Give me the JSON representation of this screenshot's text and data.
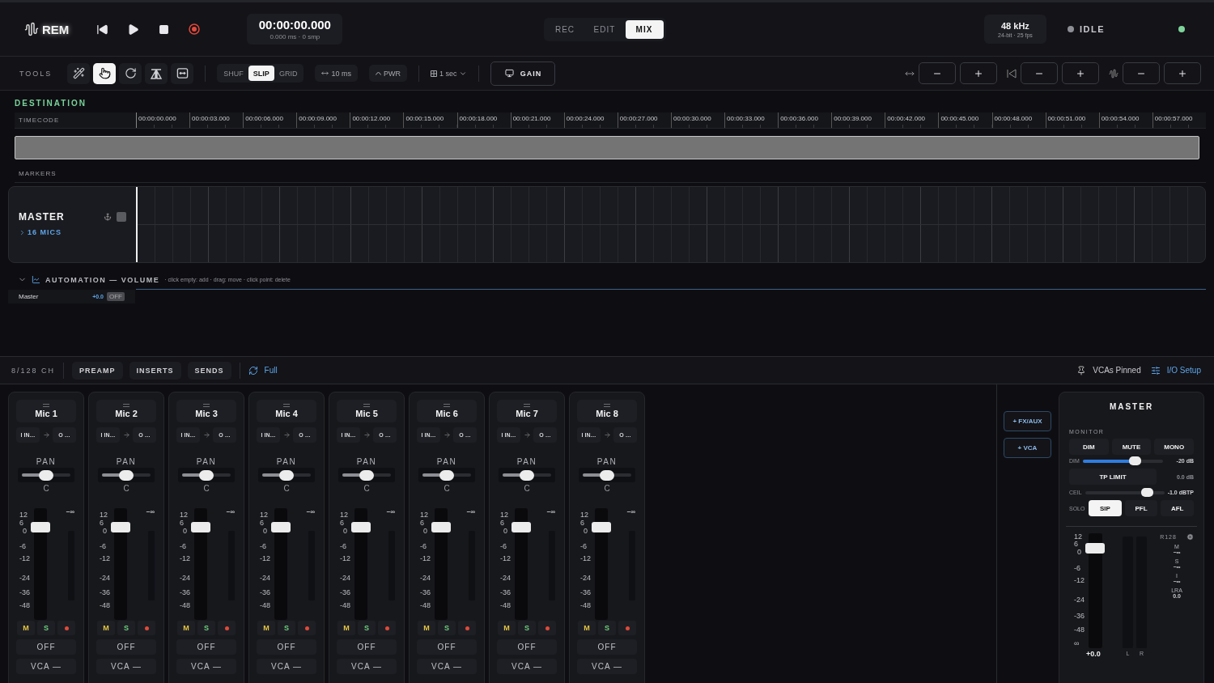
{
  "topbar": {
    "logo": "REM",
    "timecode": {
      "value": "00:00:00.000",
      "sub": "0.000 ms · 0 smp"
    },
    "modes": [
      {
        "label": "REC",
        "selected": false
      },
      {
        "label": "EDIT",
        "selected": false
      },
      {
        "label": "MIX",
        "selected": true
      }
    ],
    "format": {
      "rate": "48 kHz",
      "detail": "24-bit · 25 fps"
    },
    "status": "IDLE"
  },
  "toolbar": {
    "label": "TOOLS",
    "tools": [
      {
        "selected": false
      },
      {
        "selected": true
      },
      {
        "selected": false
      },
      {
        "selected": false
      },
      {
        "selected": false
      }
    ],
    "edit_modes": [
      {
        "label": "SHUF",
        "selected": false
      },
      {
        "label": "SLIP",
        "selected": true
      },
      {
        "label": "GRID",
        "selected": false
      }
    ],
    "nudge": "10 ms",
    "fade": "PWR",
    "grid": "1 sec",
    "gain": "GAIN"
  },
  "destination": {
    "title": "DESTINATION",
    "ruler_label": "TIMECODE",
    "ticks": [
      "00:00:00.000",
      "00:00:03.000",
      "00:00:06.000",
      "00:00:09.000",
      "00:00:12.000",
      "00:00:15.000",
      "00:00:18.000",
      "00:00:21.000",
      "00:00:24.000",
      "00:00:27.000",
      "00:00:30.000",
      "00:00:33.000",
      "00:00:36.000",
      "00:00:39.000",
      "00:00:42.000",
      "00:00:45.000",
      "00:00:48.000",
      "00:00:51.000",
      "00:00:54.000",
      "00:00:57.000"
    ],
    "markers_label": "MARKERS",
    "track": {
      "name": "MASTER",
      "group": "16 MICS"
    },
    "automation": {
      "title": "AUTOMATION — VOLUME",
      "hint": "· click empty: add · drag: move · click point: delete",
      "lanes": [
        {
          "name": "Master",
          "value": "+0.0",
          "toggle": "OFF"
        }
      ]
    }
  },
  "mixer": {
    "count": "8/128 CH",
    "sections": [
      "PREAMP",
      "INSERTS",
      "SENDS"
    ],
    "view": "Full",
    "pinned": "VCAs Pinned",
    "io": "I/O Setup",
    "channels": [
      {
        "name": "Mic 1",
        "input": "I IN…",
        "output": "O …",
        "pan_label": "PAN",
        "pan": {
          "level": 0.5
        },
        "pan_reading": "C",
        "peak": "−∞",
        "scale": [
          "12",
          "6",
          "0",
          "-6",
          "-12",
          "-24",
          "-36",
          "-48"
        ],
        "fader": {
          "level": 0.83
        },
        "mute": "M",
        "solo": "S",
        "automation": "OFF",
        "vca": "VCA —"
      },
      {
        "name": "Mic 2",
        "input": "I IN…",
        "output": "O …",
        "pan_label": "PAN",
        "pan": {
          "level": 0.5
        },
        "pan_reading": "C",
        "peak": "−∞",
        "scale": [
          "12",
          "6",
          "0",
          "-6",
          "-12",
          "-24",
          "-36",
          "-48"
        ],
        "fader": {
          "level": 0.83
        },
        "mute": "M",
        "solo": "S",
        "automation": "OFF",
        "vca": "VCA —"
      },
      {
        "name": "Mic 3",
        "input": "I IN…",
        "output": "O …",
        "pan_label": "PAN",
        "pan": {
          "level": 0.5
        },
        "pan_reading": "C",
        "peak": "−∞",
        "scale": [
          "12",
          "6",
          "0",
          "-6",
          "-12",
          "-24",
          "-36",
          "-48"
        ],
        "fader": {
          "level": 0.83
        },
        "mute": "M",
        "solo": "S",
        "automation": "OFF",
        "vca": "VCA —"
      },
      {
        "name": "Mic 4",
        "input": "I IN…",
        "output": "O …",
        "pan_label": "PAN",
        "pan": {
          "level": 0.5
        },
        "pan_reading": "C",
        "peak": "−∞",
        "scale": [
          "12",
          "6",
          "0",
          "-6",
          "-12",
          "-24",
          "-36",
          "-48"
        ],
        "fader": {
          "level": 0.83
        },
        "mute": "M",
        "solo": "S",
        "automation": "OFF",
        "vca": "VCA —"
      },
      {
        "name": "Mic 5",
        "input": "I IN…",
        "output": "O …",
        "pan_label": "PAN",
        "pan": {
          "level": 0.5
        },
        "pan_reading": "C",
        "peak": "−∞",
        "scale": [
          "12",
          "6",
          "0",
          "-6",
          "-12",
          "-24",
          "-36",
          "-48"
        ],
        "fader": {
          "level": 0.83
        },
        "mute": "M",
        "solo": "S",
        "automation": "OFF",
        "vca": "VCA —"
      },
      {
        "name": "Mic 6",
        "input": "I IN…",
        "output": "O …",
        "pan_label": "PAN",
        "pan": {
          "level": 0.5
        },
        "pan_reading": "C",
        "peak": "−∞",
        "scale": [
          "12",
          "6",
          "0",
          "-6",
          "-12",
          "-24",
          "-36",
          "-48"
        ],
        "fader": {
          "level": 0.83
        },
        "mute": "M",
        "solo": "S",
        "automation": "OFF",
        "vca": "VCA —"
      },
      {
        "name": "Mic 7",
        "input": "I IN…",
        "output": "O …",
        "pan_label": "PAN",
        "pan": {
          "level": 0.5
        },
        "pan_reading": "C",
        "peak": "−∞",
        "scale": [
          "12",
          "6",
          "0",
          "-6",
          "-12",
          "-24",
          "-36",
          "-48"
        ],
        "fader": {
          "level": 0.83
        },
        "mute": "M",
        "solo": "S",
        "automation": "OFF",
        "vca": "VCA —"
      },
      {
        "name": "Mic 8",
        "input": "I IN…",
        "output": "O …",
        "pan_label": "PAN",
        "pan": {
          "level": 0.5
        },
        "pan_reading": "C",
        "peak": "−∞",
        "scale": [
          "12",
          "6",
          "0",
          "-6",
          "-12",
          "-24",
          "-36",
          "-48"
        ],
        "fader": {
          "level": 0.83
        },
        "mute": "M",
        "solo": "S",
        "automation": "OFF",
        "vca": "VCA —"
      }
    ],
    "add_buttons": [
      "+ FX/AUX",
      "+ VCA"
    ],
    "master": {
      "title": "MASTER",
      "monitor_label": "MONITOR",
      "monitor_buttons": [
        "DIM",
        "MUTE",
        "MONO"
      ],
      "dim": {
        "label": "DIM",
        "level": 0.65,
        "reading": "-20 dB"
      },
      "tp": {
        "label": "TP LIMIT",
        "reading": "0.0 dB"
      },
      "ceil": {
        "label": "CEIL",
        "level": 0.78,
        "reading": "-1.0 dBTP"
      },
      "solo_label": "SOLO",
      "solo_modes": [
        {
          "label": "SIP",
          "selected": true
        },
        {
          "label": "PFL",
          "selected": false
        },
        {
          "label": "AFL",
          "selected": false
        }
      ],
      "scale": [
        "12",
        "6",
        "0",
        "-6",
        "-12",
        "-24",
        "-36",
        "-48",
        "∞"
      ],
      "fader": {
        "level": 0.87
      },
      "gain": "+0.0",
      "meters": [
        "L",
        "R"
      ],
      "loudness": {
        "title": "R128",
        "items": [
          {
            "label": "M",
            "value": "−∞"
          },
          {
            "label": "S",
            "value": "−∞"
          },
          {
            "label": "I",
            "value": "−∞"
          },
          {
            "label": "LRA",
            "value": "0.0"
          }
        ]
      }
    }
  }
}
